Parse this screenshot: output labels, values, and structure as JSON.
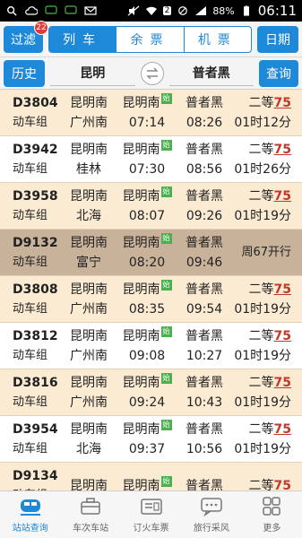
{
  "status_bar": {
    "battery": "88%",
    "time": "06:11",
    "sim_number": "2"
  },
  "top": {
    "filter_label": "过滤",
    "filter_badge": "22",
    "tabs": [
      "列车",
      "余票",
      "机票"
    ],
    "date_label": "日期"
  },
  "route": {
    "history_label": "历史",
    "from": "昆明",
    "to": "普者黑",
    "query_label": "查询"
  },
  "trains": [
    {
      "num": "D3804",
      "group": "动车组",
      "origin": "昆明南",
      "dest": "广州南",
      "dep_station": "昆明南",
      "dep_time": "07:14",
      "arr_station": "普者黑",
      "arr_time": "08:26",
      "seat": "二等",
      "seat_count": "75",
      "duration": "01时12分",
      "start_tag": "始"
    },
    {
      "num": "D3942",
      "group": "动车组",
      "origin": "昆明南",
      "dest": "桂林",
      "dep_station": "昆明南",
      "dep_time": "07:30",
      "arr_station": "普者黑",
      "arr_time": "08:56",
      "seat": "二等",
      "seat_count": "75",
      "duration": "01时26分",
      "start_tag": "始"
    },
    {
      "num": "D3958",
      "group": "动车组",
      "origin": "昆明南",
      "dest": "北海",
      "dep_station": "昆明南",
      "dep_time": "08:07",
      "arr_station": "普者黑",
      "arr_time": "09:26",
      "seat": "二等",
      "seat_count": "75",
      "duration": "01时19分",
      "start_tag": "始"
    },
    {
      "num": "D9132",
      "group": "动车组",
      "origin": "昆明南",
      "dest": "富宁",
      "dep_station": "昆明南",
      "dep_time": "08:20",
      "arr_station": "普者黑",
      "arr_time": "09:46",
      "notice": "周67开行",
      "start_tag": "始"
    },
    {
      "num": "D3808",
      "group": "动车组",
      "origin": "昆明南",
      "dest": "广州南",
      "dep_station": "昆明南",
      "dep_time": "08:35",
      "arr_station": "普者黑",
      "arr_time": "09:54",
      "seat": "二等",
      "seat_count": "75",
      "duration": "01时19分",
      "start_tag": "始"
    },
    {
      "num": "D3812",
      "group": "动车组",
      "origin": "昆明南",
      "dest": "广州南",
      "dep_station": "昆明南",
      "dep_time": "09:08",
      "arr_station": "普者黑",
      "arr_time": "10:27",
      "seat": "二等",
      "seat_count": "75",
      "duration": "01时19分",
      "start_tag": "始"
    },
    {
      "num": "D3816",
      "group": "动车组",
      "origin": "昆明南",
      "dest": "广州南",
      "dep_station": "昆明南",
      "dep_time": "09:24",
      "arr_station": "普者黑",
      "arr_time": "10:43",
      "seat": "二等",
      "seat_count": "75",
      "duration": "01时19分",
      "start_tag": "始"
    },
    {
      "num": "D3954",
      "group": "动车组",
      "origin": "昆明南",
      "dest": "北海",
      "dep_station": "昆明南",
      "dep_time": "09:37",
      "arr_station": "普者黑",
      "arr_time": "10:56",
      "seat": "二等",
      "seat_count": "75",
      "duration": "01时19分",
      "start_tag": "始"
    },
    {
      "num": "D9134",
      "group": "动车组",
      "origin": "昆明南",
      "dest": "",
      "dep_station": "昆明南",
      "dep_time": "",
      "arr_station": "普者黑",
      "arr_time": "",
      "seat": "二等",
      "seat_count": "75",
      "duration": "",
      "start_tag": "始"
    }
  ],
  "bottom_nav": [
    {
      "label": "站站查询",
      "icon": "train-icon"
    },
    {
      "label": "车次车站",
      "icon": "briefcase-icon"
    },
    {
      "label": "订火车票",
      "icon": "ticket-icon"
    },
    {
      "label": "旅行采风",
      "icon": "chat-bubble-icon"
    },
    {
      "label": "更多",
      "icon": "grid-icon"
    }
  ]
}
